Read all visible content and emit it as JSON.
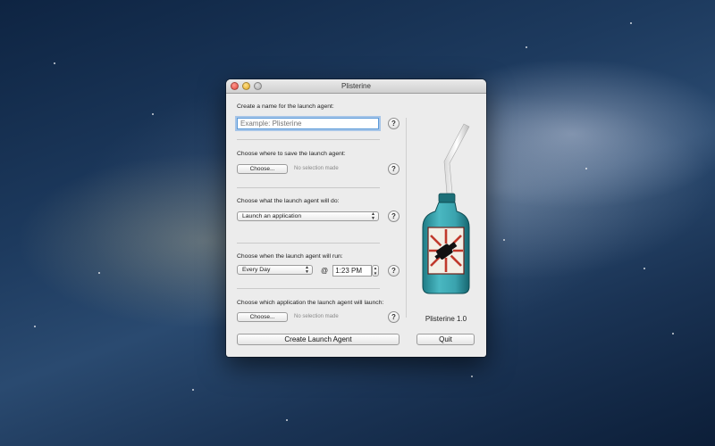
{
  "window": {
    "title": "Plisterine"
  },
  "sections": {
    "name": {
      "label": "Create a name for the launch agent:",
      "placeholder": "Example: Plisterine",
      "value": ""
    },
    "save": {
      "label": "Choose where to save the launch agent:",
      "button": "Choose...",
      "status": "No selection made"
    },
    "action": {
      "label": "Choose what the launch agent will do:",
      "selected": "Launch an application"
    },
    "schedule": {
      "label": "Choose when the launch agent will run:",
      "frequency": "Every Day",
      "at": "@",
      "time": "1:23 PM"
    },
    "app": {
      "label": "Choose which application the launch agent will launch:",
      "button": "Choose...",
      "status": "No selection made"
    }
  },
  "help_glyph": "?",
  "buttons": {
    "create": "Create Launch Agent",
    "quit": "Quit"
  },
  "version": "Plisterine 1.0",
  "icons": [
    "close-icon",
    "minimize-icon",
    "zoom-icon",
    "help-icon",
    "plisterine-bottle-icon"
  ],
  "colors": {
    "bottle": "#3aa3ae",
    "label_red": "#c0392b",
    "focus_ring": "#5b9ad9"
  }
}
